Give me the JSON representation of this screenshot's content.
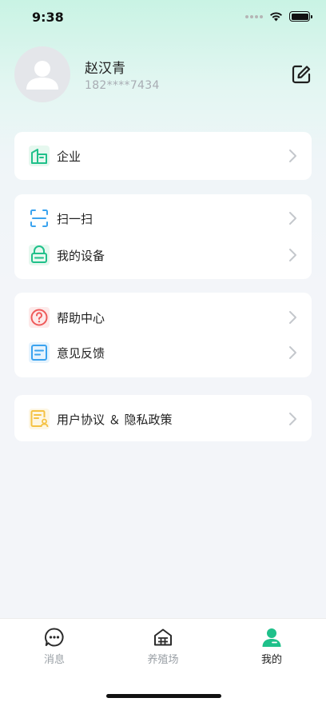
{
  "status_bar": {
    "time": "9:38"
  },
  "profile": {
    "name": "赵汉青",
    "phone": "182****7434"
  },
  "menu": {
    "enterprise": "企业",
    "scan": "扫一扫",
    "my_devices": "我的设备",
    "help_center": "帮助中心",
    "feedback": "意见反馈",
    "agreement": "用户协议 ＆ 隐私政策"
  },
  "tabbar": {
    "tabs": [
      {
        "label": "消息",
        "icon": "chat-bubble-icon",
        "active": false
      },
      {
        "label": "养殖场",
        "icon": "farm-house-icon",
        "active": false
      },
      {
        "label": "我的",
        "icon": "person-icon",
        "active": true
      }
    ]
  },
  "colors": {
    "accent": "#1fc08a",
    "icon_blue": "#3aa3ef",
    "icon_red": "#ef5a5a",
    "icon_yellow": "#f5c243"
  }
}
